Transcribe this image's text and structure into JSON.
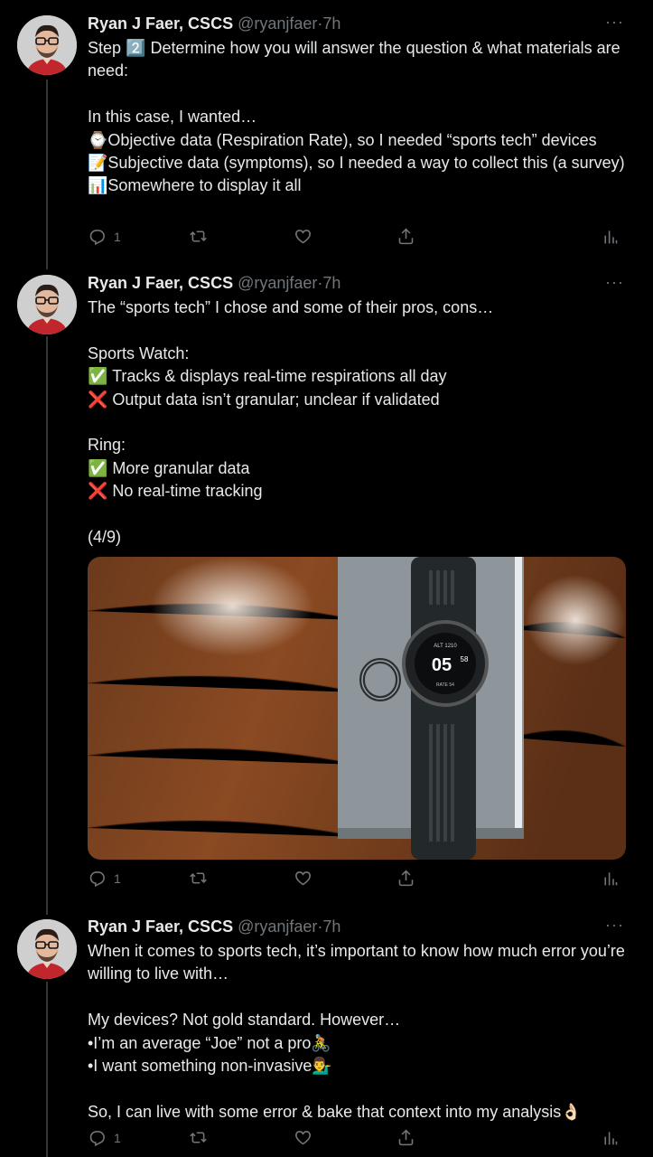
{
  "tweets": [
    {
      "name": "Ryan J Faer, CSCS",
      "handle": "@ryanjfaer",
      "dot": "·",
      "time": "7h",
      "more": "···",
      "body": "Step 2️⃣ Determine how you will answer the question & what materials are need:\n\nIn this case, I wanted…\n⌚Objective data (Respiration Rate), so I needed “sports tech” devices\n📝Subjective data (symptoms), so I needed a way to collect this (a survey)\n📊Somewhere to display it all",
      "reply_count": "1",
      "retweet_count": "",
      "like_count": ""
    },
    {
      "name": "Ryan J Faer, CSCS",
      "handle": "@ryanjfaer",
      "dot": "·",
      "time": "7h",
      "more": "···",
      "body": "The “sports tech” I chose and some of their pros, cons…\n\nSports Watch:\n✅ Tracks & displays real-time respirations all day\n❌ Output data isn’t granular; unclear if validated\n\nRing:\n✅ More granular data\n❌ No real-time tracking\n\n(4/9)",
      "reply_count": "1",
      "retweet_count": "",
      "like_count": "",
      "image": {
        "watch_text_top": "ALT 1210",
        "watch_time": "05",
        "watch_seconds": "58",
        "watch_bottom": "RATE 54"
      }
    },
    {
      "name": "Ryan J Faer, CSCS",
      "handle": "@ryanjfaer",
      "dot": "·",
      "time": "7h",
      "more": "···",
      "body": "When it comes to sports tech, it’s important to know how much error you’re willing to live with…\n\nMy devices? Not gold standard. However…\n•I’m an average “Joe” not a pro🚴\n•I want something non-invasive💁‍♂️\n\nSo, I can live with some error & bake that context into my analysis👌🏻",
      "reply_count": "1",
      "retweet_count": "",
      "like_count": ""
    }
  ],
  "icons": [
    "reply-icon",
    "retweet-icon",
    "like-icon",
    "share-icon",
    "analytics-icon"
  ],
  "colors": {
    "background": "#000000",
    "text": "#e7e9ea",
    "secondary": "#71767b",
    "thread_line": "#333639"
  }
}
